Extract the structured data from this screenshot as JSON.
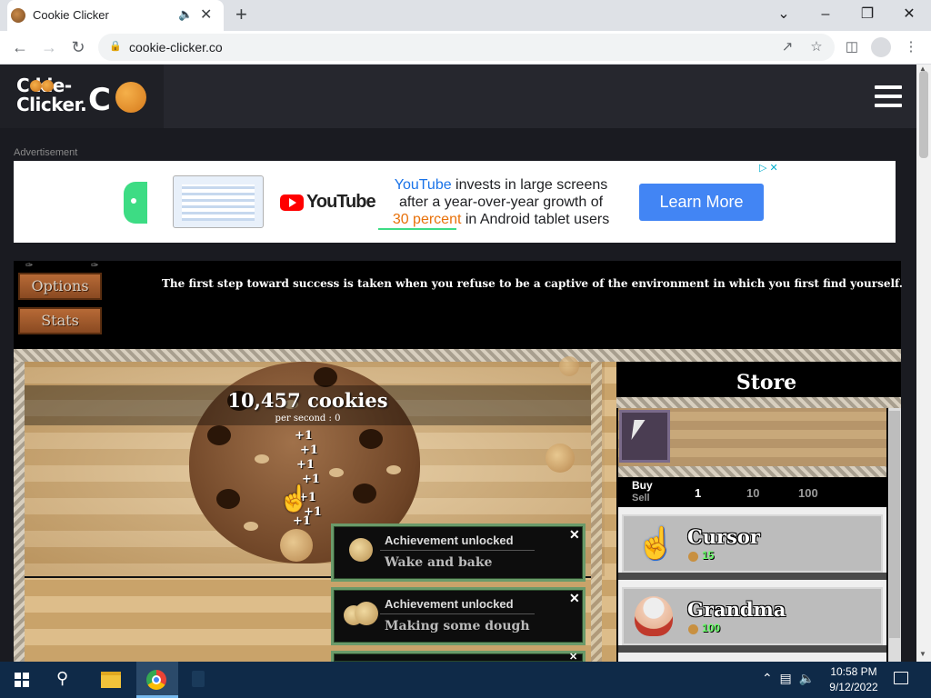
{
  "browser": {
    "tab_title": "Cookie Clicker",
    "tab_audio_icon": "speaker-icon",
    "url": "cookie-clicker.co",
    "window_controls": [
      "minimize",
      "restore",
      "close"
    ]
  },
  "site": {
    "logo_line1": "C  kie-",
    "logo_line2": "Clicker.",
    "logo_co": "C"
  },
  "ad": {
    "label": "Advertisement",
    "brand": "YouTube",
    "copy_brand": "YouTube",
    "copy_rest1": " invests in large screens",
    "copy_line2": "after a year-over-year growth of",
    "copy_highlight": "30 percent",
    "copy_rest3": " in Android tablet users",
    "cta": "Learn More"
  },
  "game": {
    "options_label": "Options",
    "stats_label": "Stats",
    "quote": "The first step toward success is taken when you refuse to be a captive of the environment in which you first find yourself.",
    "cookie_count": "10,457 cookies",
    "per_second": "per second : 0",
    "plus_one": "+1"
  },
  "store": {
    "title": "Store",
    "buy_label": "Buy",
    "sell_label": "Sell",
    "quantities": [
      "1",
      "10",
      "100"
    ],
    "buildings": [
      {
        "name": "Cursor",
        "price": "15"
      },
      {
        "name": "Grandma",
        "price": "100"
      }
    ]
  },
  "achievements": [
    {
      "title": "Achievement unlocked",
      "name": "Wake and bake"
    },
    {
      "title": "Achievement unlocked",
      "name": "Making some dough"
    }
  ],
  "taskbar": {
    "time": "10:58 PM",
    "date": "9/12/2022"
  },
  "colors": {
    "page_bg": "#1a1b21",
    "ad_cta": "#4285f4",
    "price_green": "#66ff66",
    "achievement_border": "#6a9a6a",
    "taskbar": "#0f2a48"
  }
}
